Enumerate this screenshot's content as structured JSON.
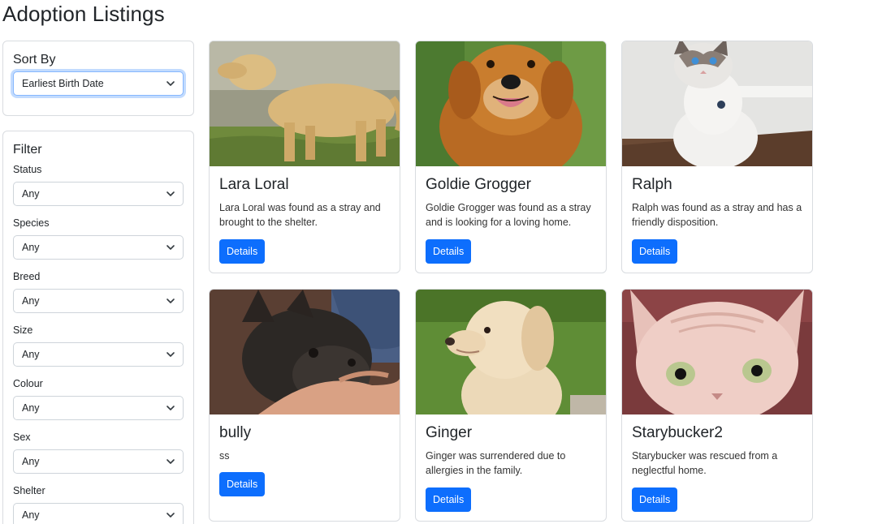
{
  "page": {
    "title": "Adoption Listings"
  },
  "sort": {
    "title": "Sort By",
    "selected": "Earliest Birth Date"
  },
  "filter": {
    "title": "Filter",
    "fields": [
      {
        "label": "Status",
        "value": "Any"
      },
      {
        "label": "Species",
        "value": "Any"
      },
      {
        "label": "Breed",
        "value": "Any"
      },
      {
        "label": "Size",
        "value": "Any"
      },
      {
        "label": "Colour",
        "value": "Any"
      },
      {
        "label": "Sex",
        "value": "Any"
      },
      {
        "label": "Shelter",
        "value": "Any"
      }
    ]
  },
  "listings": [
    {
      "name": "Lara Loral",
      "description": "Lara Loral was found as a stray and brought to the shelter.",
      "button": "Details"
    },
    {
      "name": "Goldie Grogger",
      "description": "Goldie Grogger was found as a stray and is looking for a loving home.",
      "button": "Details"
    },
    {
      "name": "Ralph",
      "description": "Ralph was found as a stray and has a friendly disposition.",
      "button": "Details"
    },
    {
      "name": "bully",
      "description": "ss",
      "button": "Details"
    },
    {
      "name": "Ginger",
      "description": "Ginger was surrendered due to allergies in the family.",
      "button": "Details"
    },
    {
      "name": "Starybucker2",
      "description": "Starybucker was rescued from a neglectful home.",
      "button": "Details"
    }
  ],
  "colors": {
    "primary": "#0d6efd",
    "border": "#d9dce0"
  }
}
